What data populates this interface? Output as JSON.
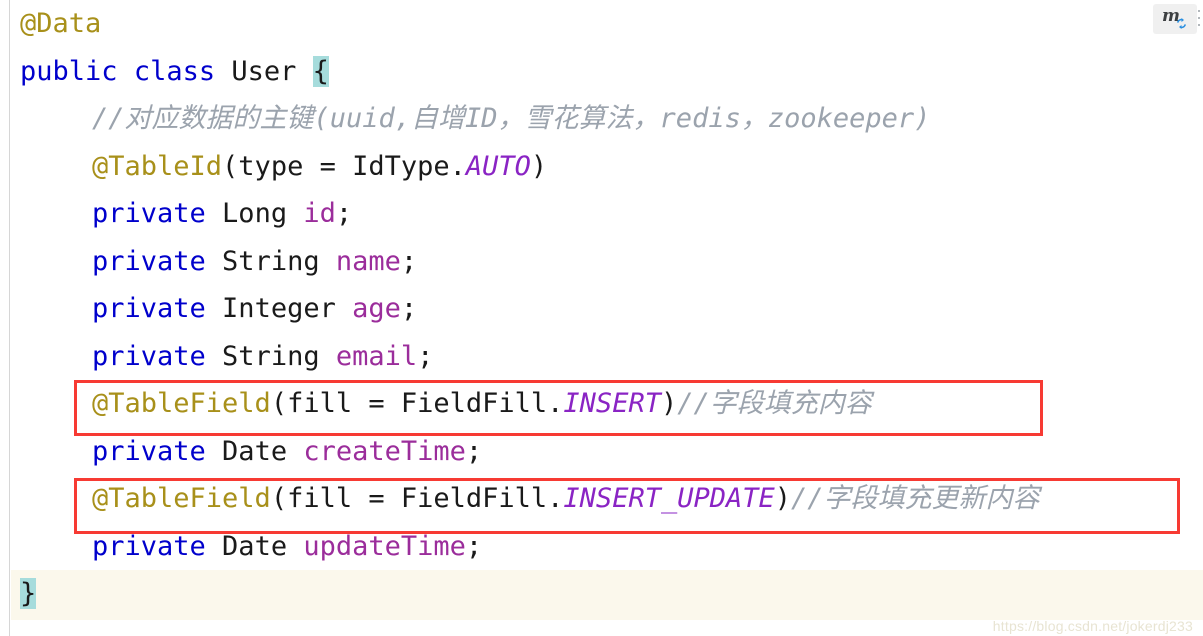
{
  "editor": {
    "language": "java",
    "colors": {
      "keyword": "#0000cc",
      "annotation": "#a8901a",
      "field": "#9b2d9b",
      "static_member": "#8a24c4",
      "comment": "#9ba3ad",
      "plain_text": "#1a1a1a",
      "brace_highlight": "#a6dcdc",
      "current_line": "#fbf8ec",
      "annotation_box": "#f73a33",
      "background": "#ffffff"
    },
    "lines": [
      {
        "id": "line-data-annotation",
        "indent": 0,
        "tokens": [
          {
            "text": "@Data",
            "style": "anno"
          }
        ]
      },
      {
        "id": "line-class-declaration",
        "indent": 0,
        "tokens": [
          {
            "text": "public",
            "style": "kw"
          },
          {
            "text": " ",
            "style": "plain"
          },
          {
            "text": "class",
            "style": "kw"
          },
          {
            "text": " ",
            "style": "plain"
          },
          {
            "text": "User",
            "style": "plain"
          },
          {
            "text": " ",
            "style": "plain"
          },
          {
            "text": "{",
            "style": "brace-hl"
          }
        ]
      },
      {
        "id": "line-primary-key-comment",
        "indent": 1,
        "tokens": [
          {
            "text": "//对应数据的主键(uuid,自增ID，雪花算法，redis，zookeeper)",
            "style": "comment"
          }
        ]
      },
      {
        "id": "line-tableid-annotation",
        "indent": 1,
        "tokens": [
          {
            "text": "@TableId",
            "style": "anno"
          },
          {
            "text": "(type = IdType.",
            "style": "plain"
          },
          {
            "text": "AUTO",
            "style": "static"
          },
          {
            "text": ")",
            "style": "plain"
          }
        ]
      },
      {
        "id": "line-field-id",
        "indent": 1,
        "tokens": [
          {
            "text": "private",
            "style": "kw"
          },
          {
            "text": " Long ",
            "style": "plain"
          },
          {
            "text": "id",
            "style": "field"
          },
          {
            "text": ";",
            "style": "plain"
          }
        ]
      },
      {
        "id": "line-field-name",
        "indent": 1,
        "tokens": [
          {
            "text": "private",
            "style": "kw"
          },
          {
            "text": " String ",
            "style": "plain"
          },
          {
            "text": "name",
            "style": "field"
          },
          {
            "text": ";",
            "style": "plain"
          }
        ]
      },
      {
        "id": "line-field-age",
        "indent": 1,
        "tokens": [
          {
            "text": "private",
            "style": "kw"
          },
          {
            "text": " Integer ",
            "style": "plain"
          },
          {
            "text": "age",
            "style": "field"
          },
          {
            "text": ";",
            "style": "plain"
          }
        ]
      },
      {
        "id": "line-field-email",
        "indent": 1,
        "tokens": [
          {
            "text": "private",
            "style": "kw"
          },
          {
            "text": " String ",
            "style": "plain"
          },
          {
            "text": "email",
            "style": "field"
          },
          {
            "text": ";",
            "style": "plain"
          }
        ]
      },
      {
        "id": "line-tablefield-insert",
        "indent": 1,
        "tokens": [
          {
            "text": "@TableField",
            "style": "anno"
          },
          {
            "text": "(fill = FieldFill.",
            "style": "plain"
          },
          {
            "text": "INSERT",
            "style": "static"
          },
          {
            "text": ")",
            "style": "plain"
          },
          {
            "text": "//字段填充内容",
            "style": "comment"
          }
        ]
      },
      {
        "id": "line-field-createtime",
        "indent": 1,
        "tokens": [
          {
            "text": "private",
            "style": "kw"
          },
          {
            "text": " Date ",
            "style": "plain"
          },
          {
            "text": "createTime",
            "style": "field"
          },
          {
            "text": ";",
            "style": "plain"
          }
        ]
      },
      {
        "id": "line-tablefield-insert-update",
        "indent": 1,
        "tokens": [
          {
            "text": "@TableField",
            "style": "anno"
          },
          {
            "text": "(fill = FieldFill.",
            "style": "plain"
          },
          {
            "text": "INSERT_UPDATE",
            "style": "static"
          },
          {
            "text": ")",
            "style": "plain"
          },
          {
            "text": "//字段填充更新内容",
            "style": "comment"
          }
        ]
      },
      {
        "id": "line-field-updatetime",
        "indent": 1,
        "tokens": [
          {
            "text": "private",
            "style": "kw"
          },
          {
            "text": " Date ",
            "style": "plain"
          },
          {
            "text": "updateTime",
            "style": "field"
          },
          {
            "text": ";",
            "style": "plain"
          }
        ]
      },
      {
        "id": "line-class-closing-brace",
        "indent": 0,
        "tokens": [
          {
            "text": "}",
            "style": "brace-hl"
          }
        ]
      }
    ]
  },
  "annotations": {
    "boxes": [
      {
        "id": "redbox-insert",
        "label": "@TableField(fill = FieldFill.INSERT)//字段填充内容"
      },
      {
        "id": "redbox-insert-update",
        "label": "@TableField(fill = FieldFill.INSERT_UPDATE)//字段填充更新内容"
      }
    ]
  },
  "widget": {
    "maven_reload_label": "m",
    "icon": "maven-reload-icon"
  },
  "watermark": {
    "text": "https://blog.csdn.net/jokerdj233"
  }
}
